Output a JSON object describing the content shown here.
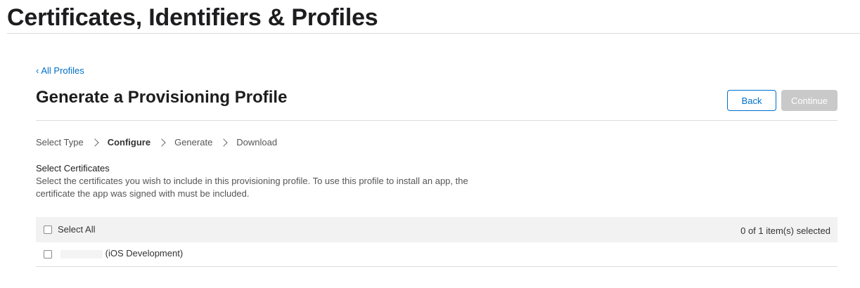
{
  "header": {
    "title": "Certificates, Identifiers & Profiles"
  },
  "nav": {
    "back_link": "All Profiles"
  },
  "page": {
    "title": "Generate a Provisioning Profile",
    "buttons": {
      "back": "Back",
      "continue": "Continue"
    }
  },
  "steps": [
    {
      "label": "Select Type",
      "active": false
    },
    {
      "label": "Configure",
      "active": true
    },
    {
      "label": "Generate",
      "active": false
    },
    {
      "label": "Download",
      "active": false
    }
  ],
  "certificates": {
    "heading": "Select Certificates",
    "description": "Select the certificates you wish to include in this provisioning profile. To use this profile to install an app, the certificate the app was signed with must be included.",
    "select_all_label": "Select All",
    "selected_count": "0 of 1 item(s) selected",
    "rows": [
      {
        "name": "(iOS Development)",
        "checked": false
      }
    ]
  },
  "colors": {
    "accent": "#0070c9",
    "disabled_button": "#c9c9c9",
    "header_bg": "#f2f2f2"
  }
}
